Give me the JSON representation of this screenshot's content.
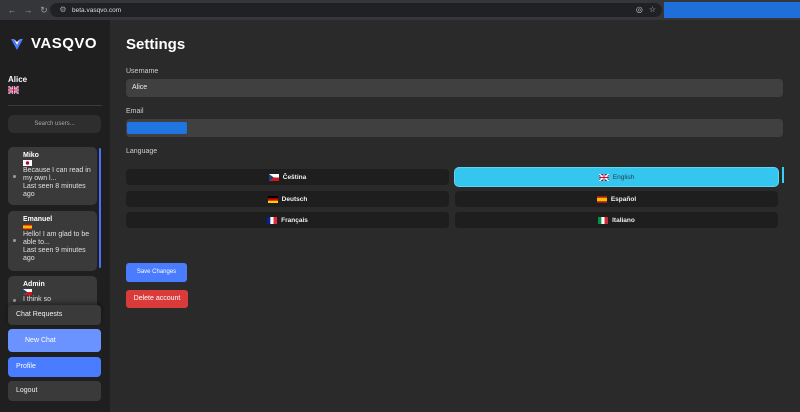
{
  "browser": {
    "url": "beta.vasqvo.com",
    "icons": [
      "back-icon",
      "forward-icon",
      "reload-icon",
      "site-info-icon",
      "eye-slash-icon",
      "star-icon"
    ]
  },
  "sidebar": {
    "logo_text": "VASQVO",
    "user": {
      "name": "Alice",
      "flag": "uk-flag-icon"
    },
    "search_placeholder": "Search users...",
    "chats": [
      {
        "name": "Miko",
        "flag": "japan-flag-icon",
        "lines": [
          "Because I can read in",
          "my own l...",
          "Last seen 8 minutes",
          "ago"
        ]
      },
      {
        "name": "Emanuel",
        "flag": "spain-flag-icon",
        "lines": [
          "Hello! I am glad to be",
          "able to...",
          "Last seen 9 minutes",
          "ago"
        ]
      },
      {
        "name": "Admin",
        "flag": "czech-flag-icon",
        "lines": [
          "I think so"
        ]
      }
    ],
    "chat_requests": "Chat Requests",
    "new_chat": "New Chat",
    "profile": "Profile",
    "logout": "Logout"
  },
  "settings": {
    "title": "Settings",
    "username_label": "Username",
    "username_value": "Alice",
    "email_label": "Email",
    "language_label": "Language",
    "languages": [
      {
        "label": "Čeština",
        "flag": "czech-flag-icon",
        "selected": false
      },
      {
        "label": "English",
        "flag": "uk-flag-icon",
        "selected": true
      },
      {
        "label": "Deutsch",
        "flag": "germany-flag-icon",
        "selected": false
      },
      {
        "label": "Español",
        "flag": "spain-flag-icon",
        "selected": false
      },
      {
        "label": "Français",
        "flag": "france-flag-icon",
        "selected": false
      },
      {
        "label": "Italiano",
        "flag": "italy-flag-icon",
        "selected": false
      }
    ],
    "save_label": "Save Changes",
    "delete_label": "Delete account"
  },
  "colors": {
    "accent": "#4a7cff",
    "selected_language": "#35c6ef",
    "danger": "#d93a3a"
  }
}
